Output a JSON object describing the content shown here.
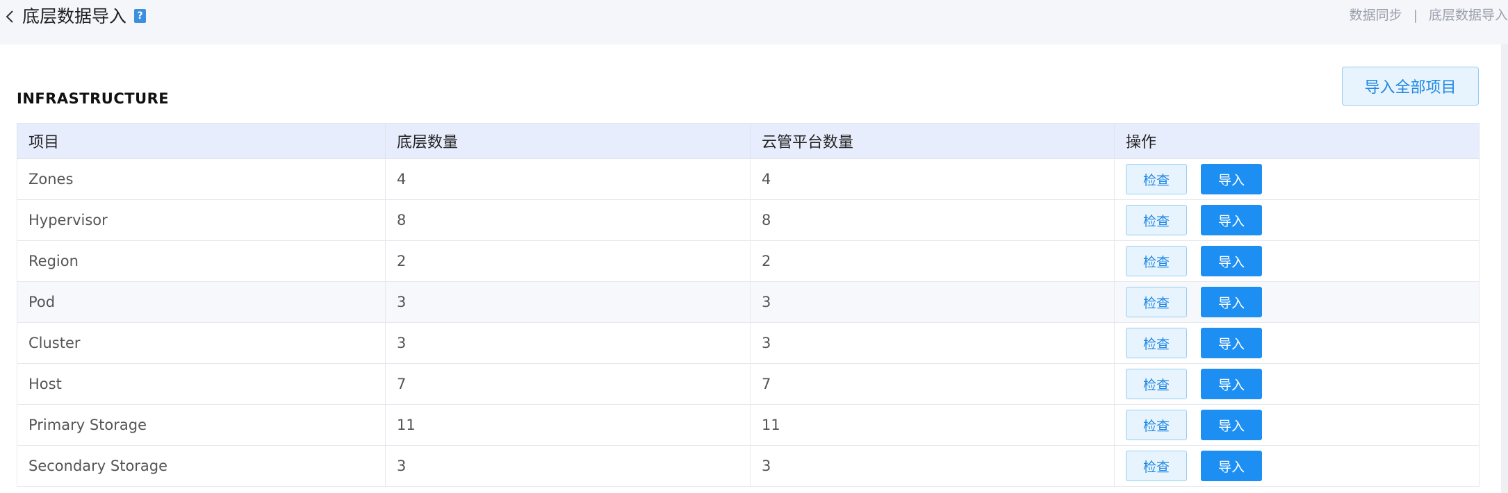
{
  "header": {
    "title": "底层数据导入",
    "help_icon": "?",
    "breadcrumb": [
      "数据同步",
      "底层数据导入"
    ],
    "breadcrumb_separator": "|"
  },
  "section": {
    "title": "INFRASTRUCTURE",
    "import_all_label": "导入全部项目"
  },
  "table": {
    "columns": [
      "项目",
      "底层数量",
      "云管平台数量",
      "操作"
    ],
    "check_label": "检查",
    "import_label": "导入",
    "rows": [
      {
        "item": "Zones",
        "base_count": "4",
        "cmp_count": "4"
      },
      {
        "item": "Hypervisor",
        "base_count": "8",
        "cmp_count": "8"
      },
      {
        "item": "Region",
        "base_count": "2",
        "cmp_count": "2"
      },
      {
        "item": "Pod",
        "base_count": "3",
        "cmp_count": "3"
      },
      {
        "item": "Cluster",
        "base_count": "3",
        "cmp_count": "3"
      },
      {
        "item": "Host",
        "base_count": "7",
        "cmp_count": "7"
      },
      {
        "item": "Primary Storage",
        "base_count": "11",
        "cmp_count": "11"
      },
      {
        "item": "Secondary Storage",
        "base_count": "3",
        "cmp_count": "3"
      }
    ]
  },
  "colors": {
    "accent": "#1e8ff2",
    "header_bg": "#e8edfd",
    "page_bg": "#f5f6fa"
  }
}
